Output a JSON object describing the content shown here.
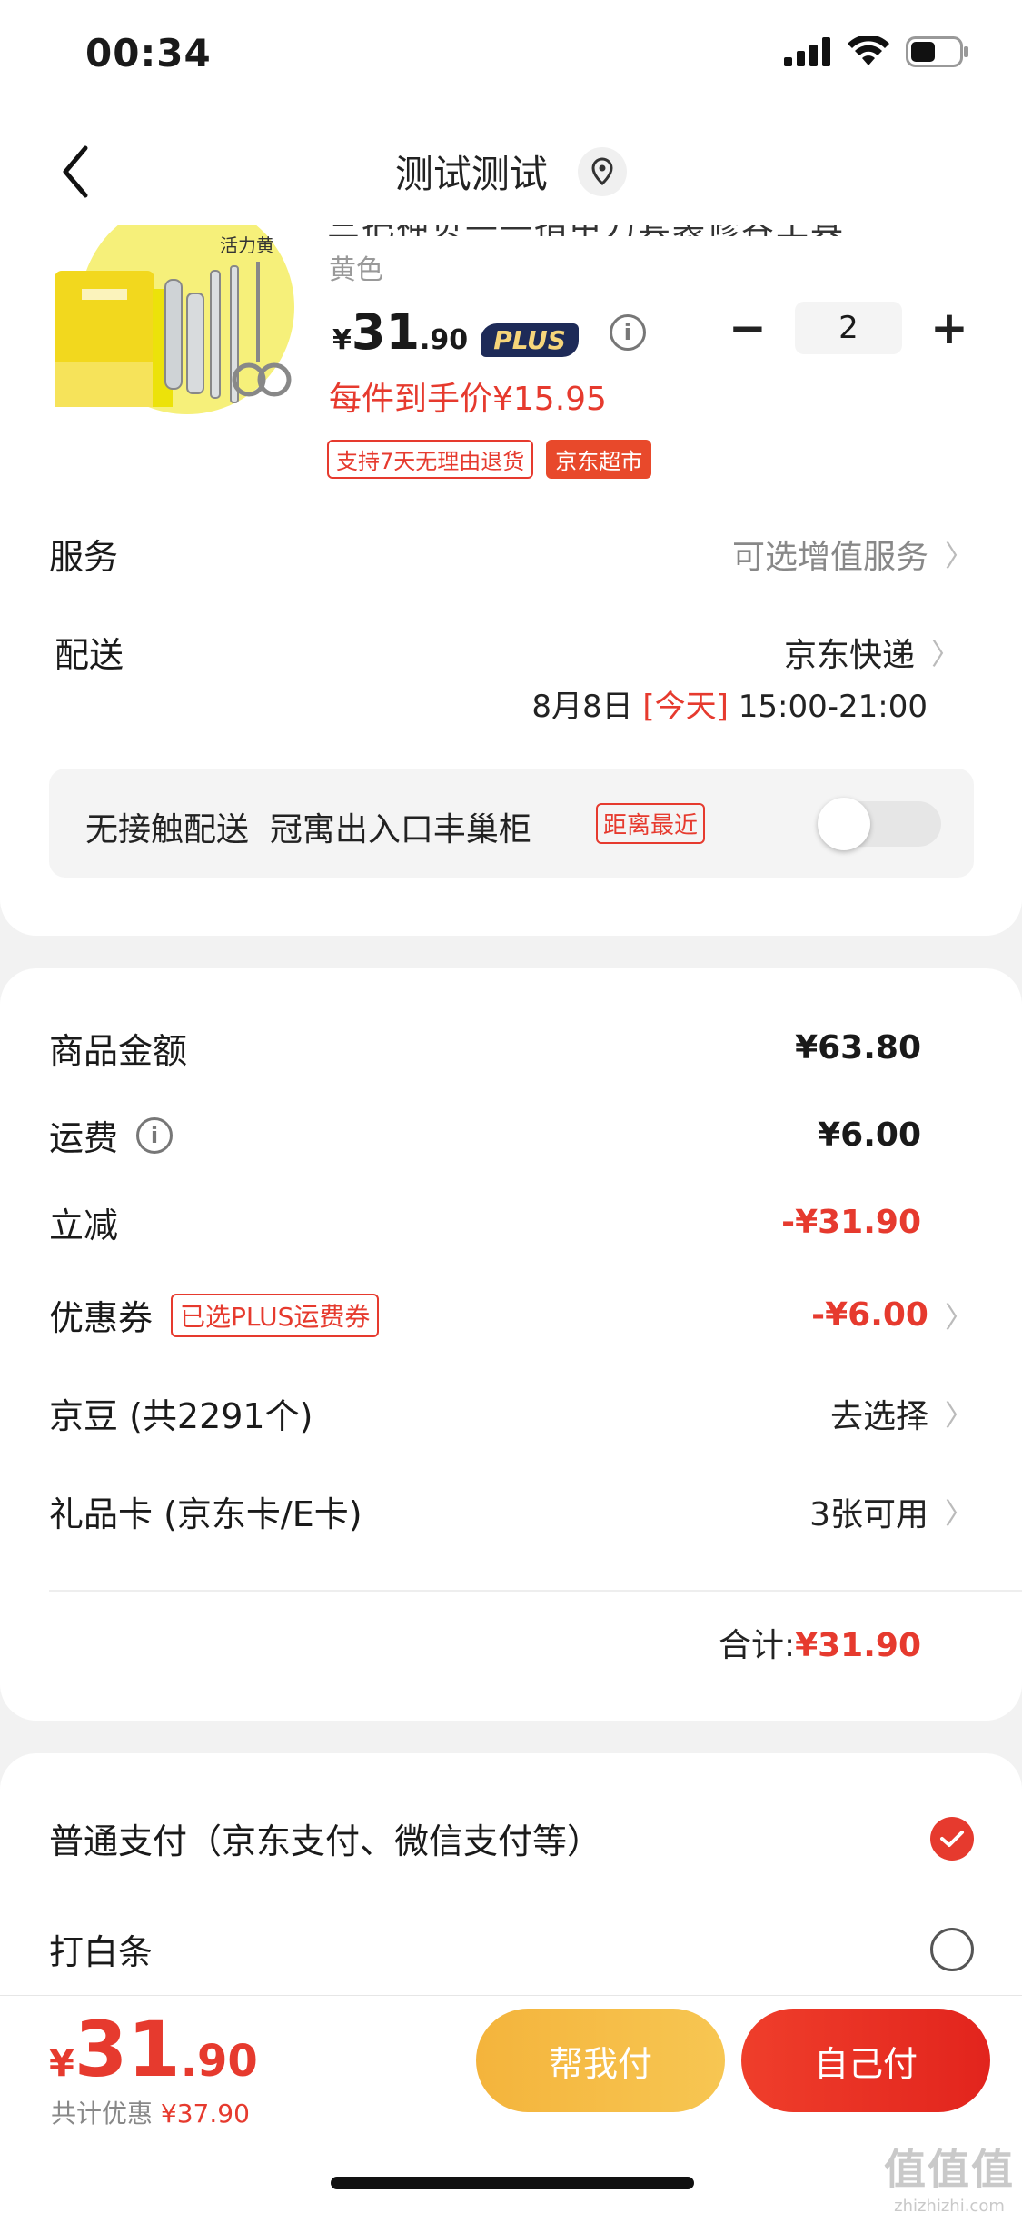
{
  "status_bar": {
    "time": "00:34",
    "icons": [
      "signal-icon",
      "wifi-icon",
      "battery-icon"
    ]
  },
  "nav": {
    "title": "测试测试",
    "back_icon": "chevron-left-icon",
    "location_icon": "location-pin-icon"
  },
  "product": {
    "image_label": "活力黄",
    "title_partial": "三把神贝——指甲刀套装修容工具",
    "variant": "黄色",
    "price_symbol": "¥",
    "price_int": "31",
    "price_dec": ".90",
    "plus_badge": "PLUS",
    "info_icon": "info-icon",
    "quantity": "2",
    "minus": "−",
    "plus": "+",
    "unit_price": "每件到手价¥15.95",
    "tags": [
      "支持7天无理由退货",
      "京东超市"
    ]
  },
  "service": {
    "label": "服务",
    "value": "可选增值服务"
  },
  "delivery": {
    "label": "配送",
    "carrier": "京东快递",
    "date": "8月8日",
    "today": "[今天]",
    "window": "15:00-21:00"
  },
  "contactless": {
    "label": "无接触配送",
    "location": "冠寓出入口丰巢柜",
    "tag": "距离最近",
    "enabled": false
  },
  "summary": {
    "goods_label": "商品金额",
    "goods_value": "¥63.80",
    "shipping_label": "运费",
    "shipping_value": "¥6.00",
    "discount_label": "立减",
    "discount_value": "-¥31.90",
    "coupon_label": "优惠券",
    "coupon_tag": "已选PLUS运费券",
    "coupon_value": "-¥6.00",
    "beans_label": "京豆 (共2291个)",
    "beans_value": "去选择",
    "giftcard_label": "礼品卡 (京东卡/E卡)",
    "giftcard_value": "3张可用",
    "total_label": "合计:",
    "total_value": "¥31.90"
  },
  "payment": {
    "options": [
      {
        "label": "普通支付（京东支付、微信支付等）",
        "selected": true
      },
      {
        "label": "打白条",
        "selected": false
      }
    ]
  },
  "bottom": {
    "symbol": "¥",
    "int": "31",
    "dec": ".90",
    "saved_label": "共计优惠",
    "saved_value": "¥37.90",
    "help_pay": "帮我付",
    "self_pay": "自己付"
  },
  "watermark": {
    "logo": "值值值",
    "domain": "zhizhizhi.com"
  },
  "colors": {
    "accent_red": "#e63a2e",
    "gold": "#f4b43c",
    "plus_navy": "#1e2b58"
  }
}
